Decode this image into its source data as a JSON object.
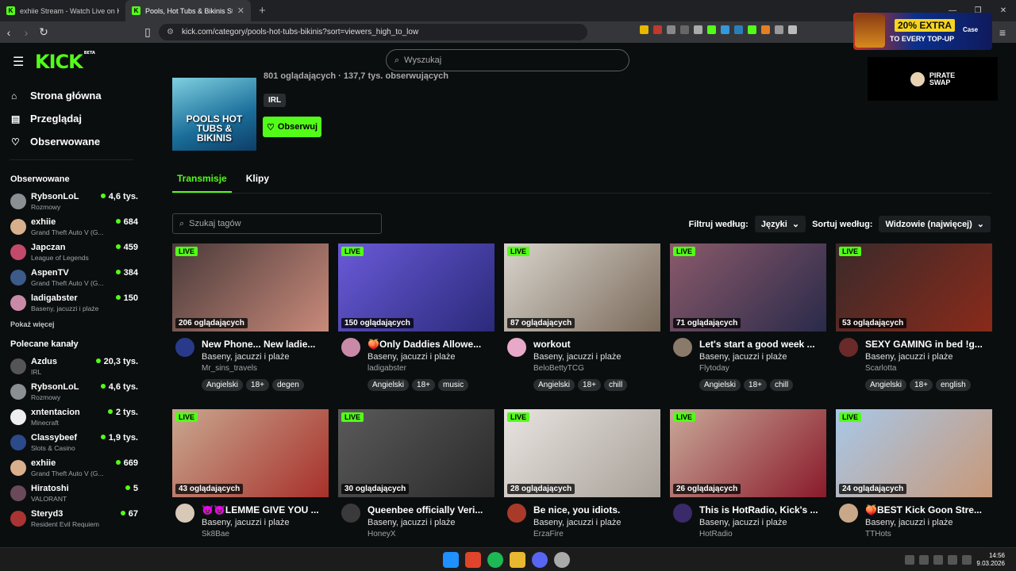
{
  "browser": {
    "tabs": [
      {
        "title": "exhiie Stream - Watch Live on Kic",
        "active": false
      },
      {
        "title": "Pools, Hot Tubs & Bikinis Stream",
        "active": true
      }
    ],
    "url": "kick.com/category/pools-hot-tubs-bikinis?sort=viewers_high_to_low"
  },
  "ads": {
    "promo_badge": "20% EXTRA",
    "promo_sub": "TO EVERY TOP-UP",
    "promo_brand": "Case",
    "pirate_l1": "PIRATE",
    "pirate_l2": "SWAP"
  },
  "header": {
    "logo": "KICK",
    "logo_beta": "BETA",
    "search_placeholder": "Wyszukaj"
  },
  "sidebar": {
    "nav": [
      {
        "label": "Strona główna",
        "icon": "home-icon"
      },
      {
        "label": "Przeglądaj",
        "icon": "browse-icon"
      },
      {
        "label": "Obserwowane",
        "icon": "heart-icon"
      }
    ],
    "followed_title": "Obserwowane",
    "followed": [
      {
        "name": "RybsonLoL",
        "category": "Rozmowy",
        "viewers": "4,6 tys.",
        "color": "#8a8f93"
      },
      {
        "name": "exhiie",
        "category": "Grand Theft Auto V (G...",
        "viewers": "684",
        "color": "#d9b08c"
      },
      {
        "name": "Japczan",
        "category": "League of Legends",
        "viewers": "459",
        "color": "#c34a6a"
      },
      {
        "name": "AspenTV",
        "category": "Grand Theft Auto V (G...",
        "viewers": "384",
        "color": "#3c5a8a"
      },
      {
        "name": "ladigabster",
        "category": "Baseny, jacuzzi i plaże",
        "viewers": "150",
        "color": "#c98aa8"
      }
    ],
    "show_more": "Pokaż więcej",
    "recommended_title": "Polecane kanały",
    "recommended": [
      {
        "name": "Azdus",
        "category": "IRL",
        "viewers": "20,3 tys.",
        "color": "#555"
      },
      {
        "name": "RybsonLoL",
        "category": "Rozmowy",
        "viewers": "4,6 tys.",
        "color": "#8a8f93"
      },
      {
        "name": "xntentacion",
        "category": "Minecraft",
        "viewers": "2 tys.",
        "color": "#eee"
      },
      {
        "name": "Classybeef",
        "category": "Slots & Casino",
        "viewers": "1,9 tys.",
        "color": "#2a4a8a"
      },
      {
        "name": "exhiie",
        "category": "Grand Theft Auto V (G...",
        "viewers": "669",
        "color": "#d9b08c"
      },
      {
        "name": "Hiratoshi",
        "category": "VALORANT",
        "viewers": "5",
        "color": "#6a4a5a"
      },
      {
        "name": "Steryd3",
        "category": "Resident Evil Requiem",
        "viewers": "67",
        "color": "#a33"
      }
    ]
  },
  "category": {
    "cover_text": "POOLS HOT TUBS & BIKINIS",
    "stats": "801 oglądających · 137,7 tys. obserwujących",
    "tag": "IRL",
    "follow_label": "Obserwuj",
    "tabs": [
      {
        "label": "Transmisje",
        "active": true
      },
      {
        "label": "Klipy",
        "active": false
      }
    ]
  },
  "filters": {
    "tag_search_placeholder": "Szukaj tagów",
    "filter_label": "Filtruj według:",
    "language": "Języki",
    "sort_label": "Sortuj według:",
    "sort_value": "Widzowie (najwięcej)"
  },
  "live_label": "LIVE",
  "streams": [
    {
      "viewers": "206 oglądających",
      "title": "New Phone... New ladie...",
      "category": "Baseny, jacuzzi i plaże",
      "streamer": "Mr_sins_travels",
      "tags": [
        "Angielski",
        "18+",
        "degen"
      ],
      "thumb": [
        "#4a3a3a",
        "#c98a7a"
      ],
      "avatar": "#2a3a8a"
    },
    {
      "viewers": "150 oglądających",
      "title": "🍑Only Daddies Allowe...",
      "category": "Baseny, jacuzzi i plaże",
      "streamer": "ladigabster",
      "tags": [
        "Angielski",
        "18+",
        "music"
      ],
      "thumb": [
        "#6a5ad8",
        "#2a2a7a"
      ],
      "avatar": "#c98aa8"
    },
    {
      "viewers": "87 oglądających",
      "title": "workout",
      "category": "Baseny, jacuzzi i plaże",
      "streamer": "BeloBettyTCG",
      "tags": [
        "Angielski",
        "18+",
        "chill"
      ],
      "thumb": [
        "#d8d4cc",
        "#7a6a5a"
      ],
      "avatar": "#e8a8c8"
    },
    {
      "viewers": "71 oglądających",
      "title": "Let's start a good week ...",
      "category": "Baseny, jacuzzi i plaże",
      "streamer": "Flytoday",
      "tags": [
        "Angielski",
        "18+",
        "chill"
      ],
      "thumb": [
        "#8a5a6a",
        "#2a2a4a"
      ],
      "avatar": "#8a7a6a"
    },
    {
      "viewers": "53 oglądających",
      "title": "SEXY GAMING in bed !g...",
      "category": "Baseny, jacuzzi i plaże",
      "streamer": "Scarlotta",
      "tags": [
        "Angielski",
        "18+",
        "english"
      ],
      "thumb": [
        "#3a2a2a",
        "#8a2a1a"
      ],
      "avatar": "#6a2a2a"
    },
    {
      "viewers": "43 oglądających",
      "title": "😈😈LEMME GIVE YOU ...",
      "category": "Baseny, jacuzzi i plaże",
      "streamer": "Sk8Bae",
      "tags": [],
      "thumb": [
        "#c8a890",
        "#a8302a"
      ],
      "avatar": "#d8c8b8"
    },
    {
      "viewers": "30 oglądających",
      "title": "Queenbee officially Veri...",
      "category": "Baseny, jacuzzi i plaże",
      "streamer": "HoneyX",
      "tags": [],
      "thumb": [
        "#5a5a5a",
        "#2a2a2a"
      ],
      "avatar": "#3a3a3a"
    },
    {
      "viewers": "28 oglądających",
      "title": "Be nice, you idiots.",
      "category": "Baseny, jacuzzi i plaże",
      "streamer": "ErzaFire",
      "tags": [],
      "thumb": [
        "#e8e4e0",
        "#a8a098"
      ],
      "avatar": "#a83a2a"
    },
    {
      "viewers": "26 oglądających",
      "title": "This is HotRadio, Kick's ...",
      "category": "Baseny, jacuzzi i plaże",
      "streamer": "HotRadio",
      "tags": [],
      "thumb": [
        "#c8a898",
        "#8a1a2a"
      ],
      "avatar": "#3a2a6a"
    },
    {
      "viewers": "24 oglądających",
      "title": "🍑BEST Kick Goon Stre...",
      "category": "Baseny, jacuzzi i plaże",
      "streamer": "TTHots",
      "tags": [],
      "thumb": [
        "#a8c8e8",
        "#c89878"
      ],
      "avatar": "#c8a888"
    }
  ],
  "taskbar": {
    "time": "14:56",
    "date": "9.03.2026"
  },
  "colors": {
    "accent": "#53fc18",
    "background": "#0b0e0f"
  }
}
